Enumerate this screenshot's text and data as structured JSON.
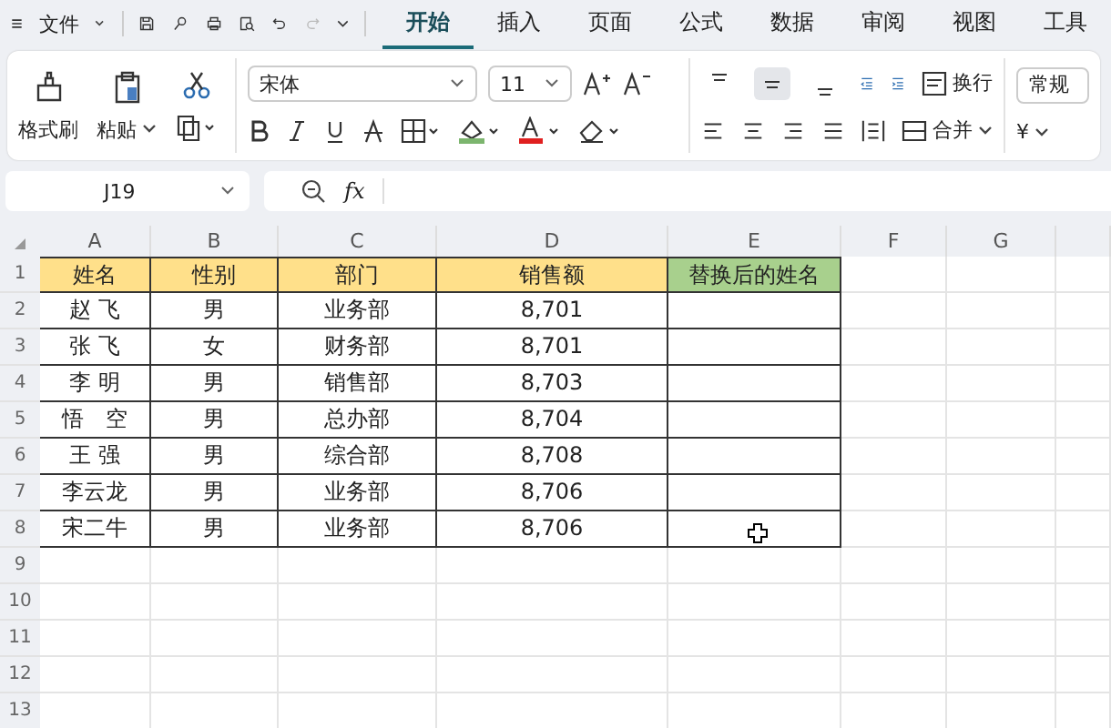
{
  "menu": {
    "file": "文件"
  },
  "tabs": [
    {
      "label": "开始",
      "selected": true
    },
    {
      "label": "插入",
      "selected": false
    },
    {
      "label": "页面",
      "selected": false
    },
    {
      "label": "公式",
      "selected": false
    },
    {
      "label": "数据",
      "selected": false
    },
    {
      "label": "审阅",
      "selected": false
    },
    {
      "label": "视图",
      "selected": false
    },
    {
      "label": "工具",
      "selected": false
    }
  ],
  "ribbon": {
    "format_painter": "格式刷",
    "paste": "粘贴",
    "font_name": "宋体",
    "font_size": "11",
    "vertical_align": [
      {
        "selected": false
      },
      {
        "selected": true
      },
      {
        "selected": false
      }
    ],
    "wrap": "换行",
    "merge": "合并",
    "number_format": "常规",
    "currency": "¥"
  },
  "formula_bar": {
    "name_box": "J19",
    "fx": "fx"
  },
  "columns": [
    "A",
    "B",
    "C",
    "D",
    "E",
    "F",
    "G"
  ],
  "row_numbers": [
    "1",
    "2",
    "3",
    "4",
    "5",
    "6",
    "7",
    "8",
    "9",
    "10",
    "11",
    "12",
    "13"
  ],
  "table": {
    "header": [
      {
        "text": "姓名",
        "color": "#ffe08a"
      },
      {
        "text": "性别",
        "color": "#ffe08a"
      },
      {
        "text": "部门",
        "color": "#ffe08a"
      },
      {
        "text": "销售额",
        "color": "#ffe08a"
      },
      {
        "text": "替换后的姓名",
        "color": "#a8d08d"
      }
    ],
    "rows": [
      [
        "赵 飞",
        "男",
        "业务部",
        "8,701",
        ""
      ],
      [
        "张 飞",
        "女",
        "财务部",
        "8,701",
        ""
      ],
      [
        "李 明",
        "男",
        "销售部",
        "8,703",
        ""
      ],
      [
        "悟　空",
        "男",
        "总办部",
        "8,704",
        ""
      ],
      [
        "王 强",
        "男",
        "综合部",
        "8,708",
        ""
      ],
      [
        "李云龙",
        "男",
        "业务部",
        "8,706",
        ""
      ],
      [
        "宋二牛",
        "男",
        "业务部",
        "8,706",
        ""
      ]
    ]
  }
}
